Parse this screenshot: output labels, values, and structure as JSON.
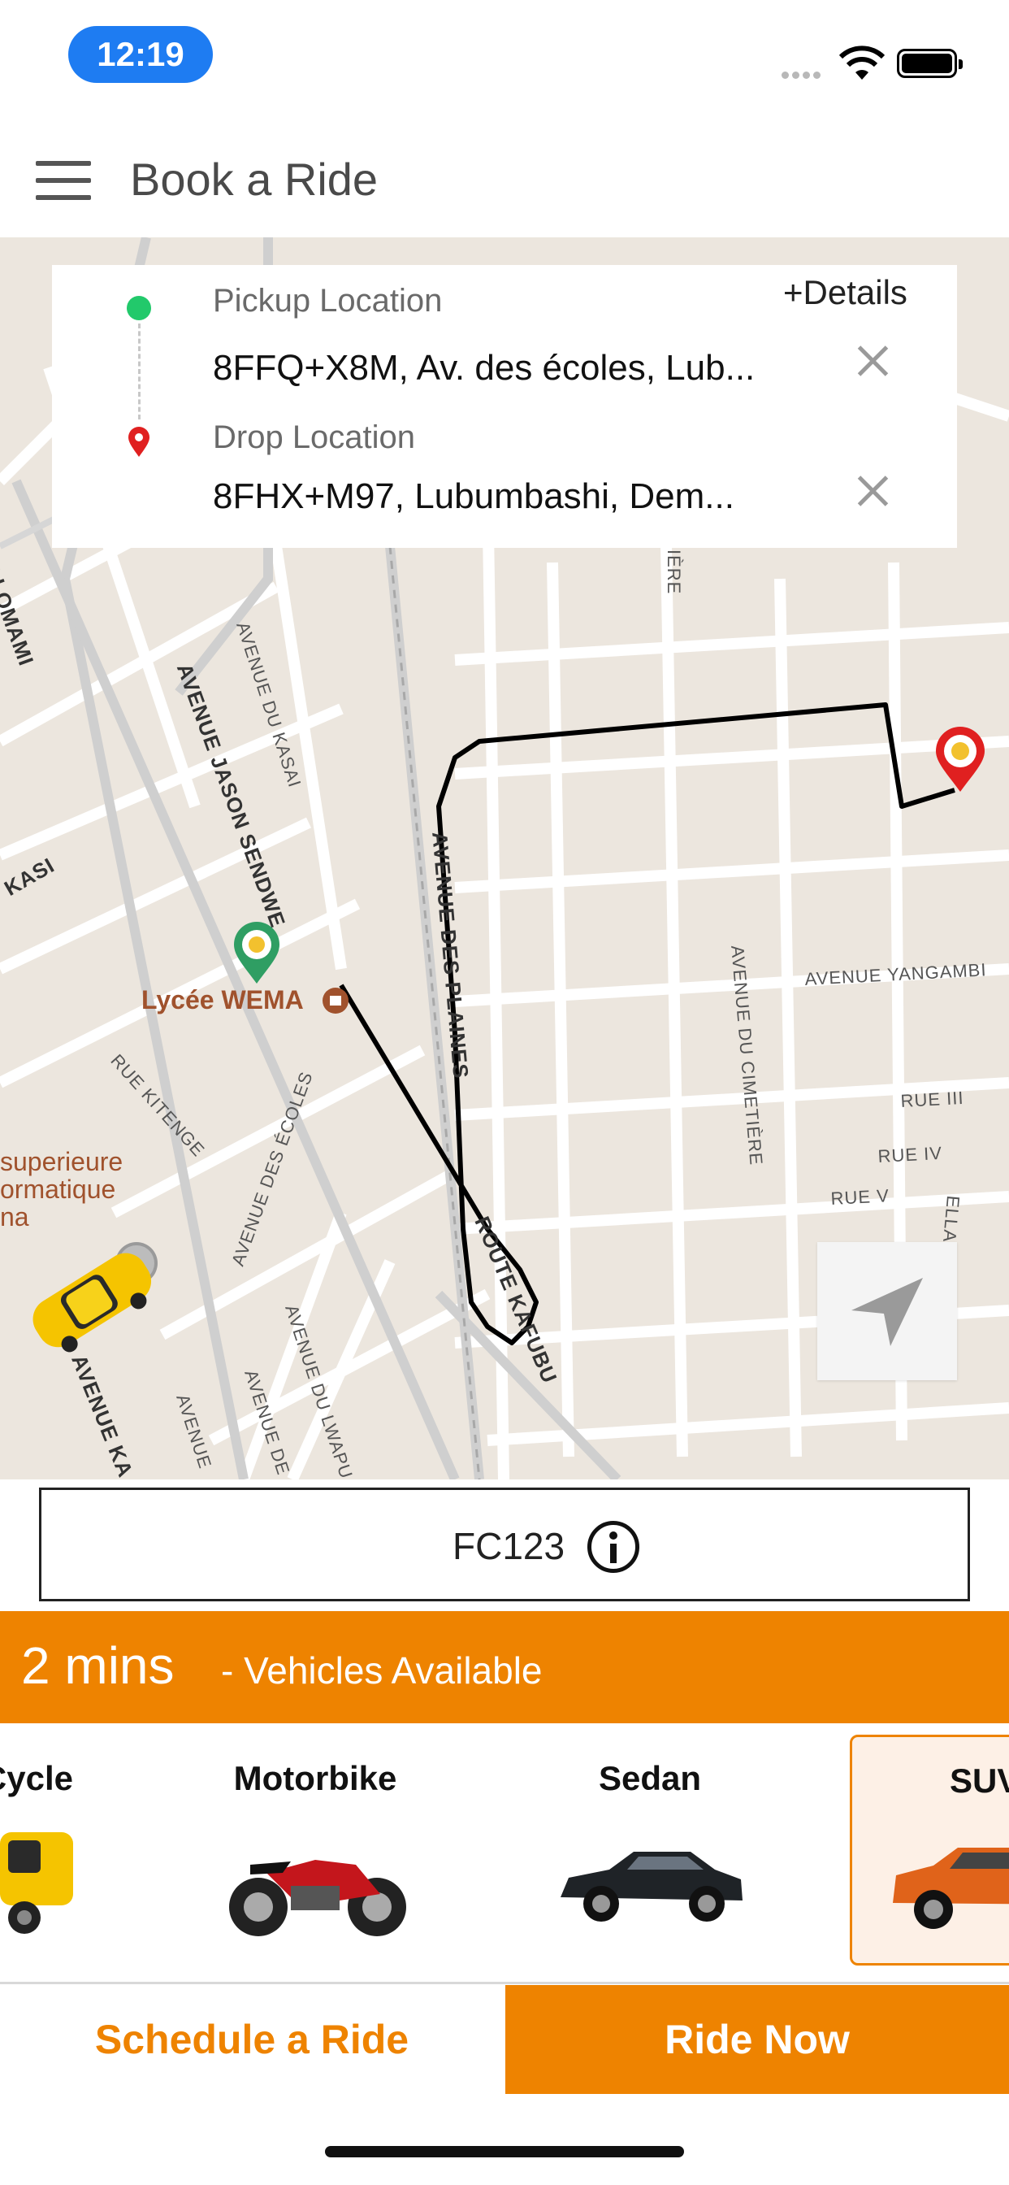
{
  "status_bar": {
    "time": "12:19"
  },
  "header": {
    "title": "Book a Ride"
  },
  "locations": {
    "details_link": "+Details",
    "pickup_label": "Pickup Location",
    "pickup_value": "8FFQ+X8M, Av. des écoles, Lub...",
    "drop_label": "Drop Location",
    "drop_value": "8FHX+M97, Lubumbashi, Dem..."
  },
  "map": {
    "poi_name": "Lycée WEMA",
    "poi_partial": "superieure\normatique\nna",
    "streets": {
      "lomami": "U LOMAMI",
      "jason": "AVENUE JASON SENDWE",
      "kasai": "AVENUE DU KASAI",
      "kasi": "KASI",
      "plaines": "AVENUE DES PLAINES",
      "kafubu": "ROUTE KAFUBU",
      "cimetiere": "AVENUE DU CIMETIÈRE",
      "yangambi": "AVENUE YANGAMBI",
      "rue3": "RUE III",
      "rue4": "RUE IV",
      "rue5": "RUE V",
      "kitenge": "RUE KITENGE",
      "ecoles": "AVENUE DES ÉCOLES",
      "lwapula": "AVENUE DU LWAPU",
      "ka": "AVENUE KA",
      "de": "AVENUE DE",
      "ue": "AVENUE",
      "iere": "IÈRE",
      "ella": "ELLA"
    }
  },
  "promo": {
    "code": "FC123"
  },
  "availability": {
    "time": "2 mins",
    "text": "- Vehicles Available"
  },
  "vehicles": [
    {
      "name": "Cycle"
    },
    {
      "name": "Motorbike"
    },
    {
      "name": "Sedan"
    },
    {
      "name": "SUV"
    }
  ],
  "actions": {
    "schedule": "Schedule a Ride",
    "ride_now": "Ride Now"
  },
  "colors": {
    "accent": "#ee8300",
    "pickup": "#22c96b",
    "drop": "#e02020"
  }
}
